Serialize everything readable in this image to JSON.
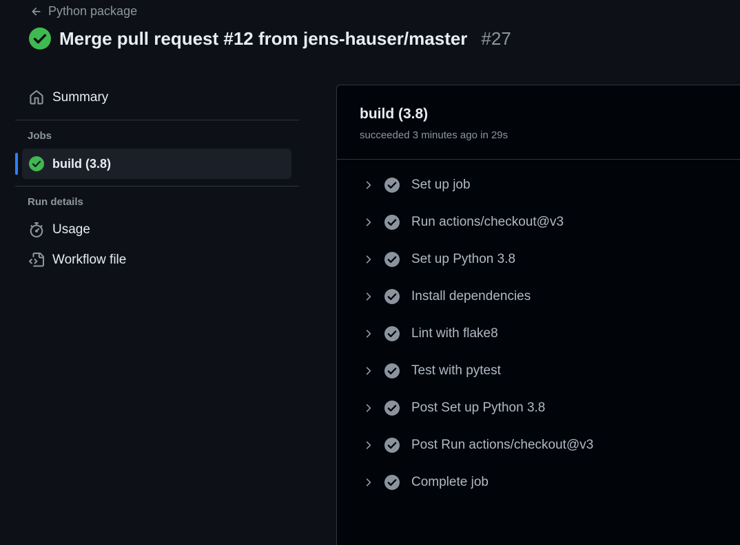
{
  "header": {
    "back_label": "Python package",
    "title": "Merge pull request #12 from jens-hauser/master",
    "run_number": "#27"
  },
  "sidebar": {
    "summary_label": "Summary",
    "jobs_heading": "Jobs",
    "job_label": "build (3.8)",
    "run_details_heading": "Run details",
    "usage_label": "Usage",
    "workflow_file_label": "Workflow file"
  },
  "job": {
    "title": "build (3.8)",
    "meta": "succeeded 3 minutes ago in 29s"
  },
  "steps": [
    {
      "label": "Set up job"
    },
    {
      "label": "Run actions/checkout@v3"
    },
    {
      "label": "Set up Python 3.8"
    },
    {
      "label": "Install dependencies"
    },
    {
      "label": "Lint with flake8"
    },
    {
      "label": "Test with pytest"
    },
    {
      "label": "Post Set up Python 3.8"
    },
    {
      "label": "Post Run actions/checkout@v3"
    },
    {
      "label": "Complete job"
    }
  ],
  "colors": {
    "success": "#3fb950",
    "step_check": "#8b949e",
    "accent": "#2f81f7",
    "background": "#0d1117",
    "panel": "#010409"
  }
}
